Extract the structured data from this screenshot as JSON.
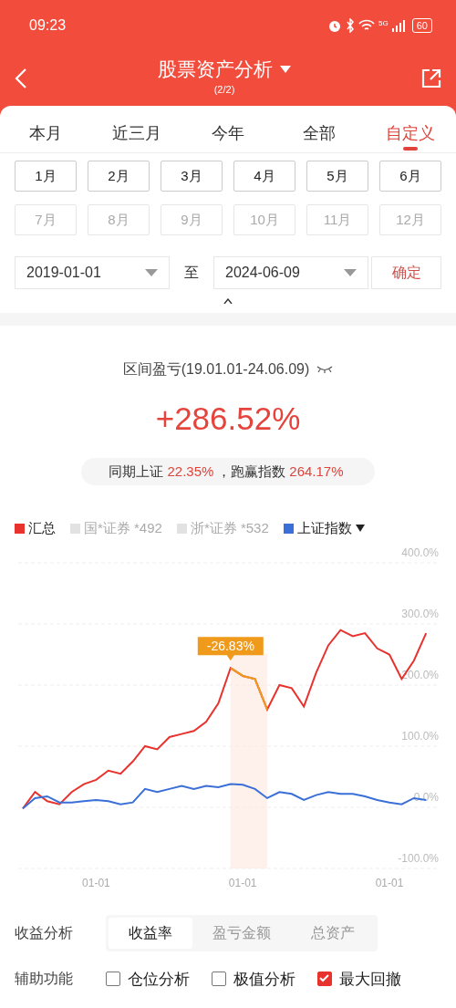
{
  "status_bar": {
    "time": "09:23",
    "network": "5G",
    "battery": "60"
  },
  "header": {
    "title": "股票资产分析",
    "subtitle": "(2/2)"
  },
  "tabs": [
    {
      "label": "本月",
      "selected": false
    },
    {
      "label": "近三月",
      "selected": false
    },
    {
      "label": "今年",
      "selected": false
    },
    {
      "label": "全部",
      "selected": false
    },
    {
      "label": "自定义",
      "selected": true
    }
  ],
  "months": [
    {
      "label": "1月",
      "disabled": false
    },
    {
      "label": "2月",
      "disabled": false
    },
    {
      "label": "3月",
      "disabled": false
    },
    {
      "label": "4月",
      "disabled": false
    },
    {
      "label": "5月",
      "disabled": false
    },
    {
      "label": "6月",
      "disabled": false
    },
    {
      "label": "7月",
      "disabled": true
    },
    {
      "label": "8月",
      "disabled": true
    },
    {
      "label": "9月",
      "disabled": true
    },
    {
      "label": "10月",
      "disabled": true
    },
    {
      "label": "11月",
      "disabled": true
    },
    {
      "label": "12月",
      "disabled": true
    }
  ],
  "date_range": {
    "start": "2019-01-01",
    "separator": "至",
    "end": "2024-06-09",
    "confirm": "确定"
  },
  "summary": {
    "title": "区间盈亏(19.01.01-24.06.09)",
    "total": "+286.52%",
    "comparison": [
      {
        "kind": "label",
        "text": "同期上证"
      },
      {
        "kind": "value",
        "text": "22.35%"
      },
      {
        "kind": "label",
        "text": "，跑赢指数"
      },
      {
        "kind": "value",
        "text": "264.17%"
      }
    ]
  },
  "hidden_series": [
    {
      "label": "国*证券 *492",
      "color": "#e2e2e2"
    },
    {
      "label": "浙*证券 *532",
      "color": "#e2e2e2"
    }
  ],
  "drawdown": {
    "color": "#f09a1c"
  },
  "chart_data": {
    "type": "line",
    "categories": [
      null,
      null,
      null,
      null,
      null,
      null,
      "01-01",
      null,
      null,
      null,
      null,
      null,
      null,
      null,
      null,
      null,
      null,
      null,
      "01-01",
      null,
      null,
      null,
      null,
      null,
      null,
      null,
      null,
      null,
      null,
      null,
      "01-01",
      null,
      null,
      null
    ],
    "ylim": [
      -100,
      400
    ],
    "grid": true,
    "yticks": [
      {
        "value": 400,
        "label": "400.0%"
      },
      {
        "value": 300,
        "label": "300.0%"
      },
      {
        "value": 200,
        "label": "200.0%"
      },
      {
        "value": 100,
        "label": "100.0%"
      },
      {
        "value": 0,
        "label": "0.0%"
      },
      {
        "value": -100,
        "label": "-100.0%"
      }
    ],
    "series": [
      {
        "name": "汇总",
        "color": "#e8322e",
        "values": [
          -2,
          25,
          10,
          5,
          25,
          38,
          45,
          60,
          55,
          75,
          100,
          95,
          115,
          120,
          125,
          140,
          170,
          228,
          215,
          210,
          160,
          200,
          195,
          165,
          220,
          265,
          290,
          280,
          285,
          260,
          250,
          210,
          240,
          285
        ]
      },
      {
        "name": "上证指数",
        "color": "#3a6fd8",
        "values": [
          -2,
          15,
          18,
          8,
          8,
          10,
          12,
          10,
          5,
          8,
          30,
          25,
          30,
          35,
          30,
          35,
          33,
          38,
          37,
          30,
          15,
          25,
          22,
          12,
          20,
          25,
          22,
          22,
          18,
          12,
          8,
          5,
          15,
          12
        ]
      }
    ],
    "annotations": [
      {
        "text": "-26.83%"
      }
    ]
  },
  "analysis": {
    "label": "收益分析",
    "options": [
      {
        "label": "收益率",
        "selected": true
      },
      {
        "label": "盈亏金额",
        "selected": false
      },
      {
        "label": "总资产",
        "selected": false
      }
    ]
  },
  "aux": {
    "label": "辅助功能",
    "options": [
      {
        "label": "仓位分析",
        "checked": false
      },
      {
        "label": "极值分析",
        "checked": false
      },
      {
        "label": "最大回撤",
        "checked": true
      }
    ]
  }
}
